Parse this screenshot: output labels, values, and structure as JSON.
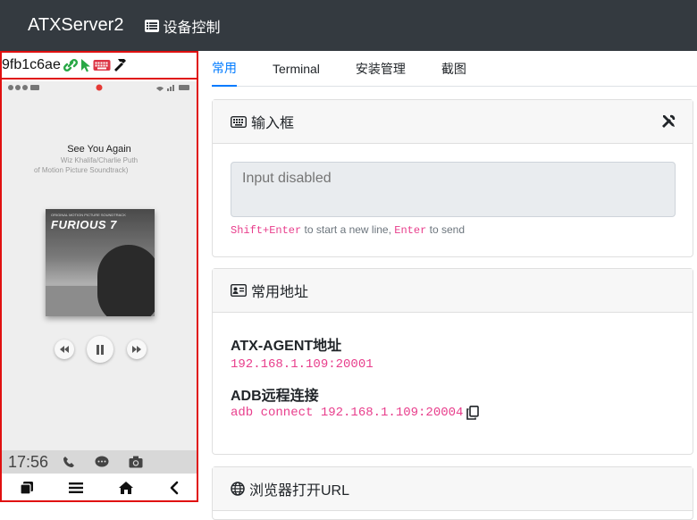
{
  "navbar": {
    "brand": "ATXServer2",
    "device_control": "设备控制"
  },
  "device": {
    "serial": "9fb1c6ae"
  },
  "phone": {
    "song_title": "See You Again",
    "song_artist": "Wiz Khalifa/Charlie Puth",
    "song_album": "of Motion Picture Soundtrack)",
    "album_title": "FURIOUS 7",
    "album_subtitle": "ORIGINAL MOTION PICTURE SOUNDTRACK",
    "clock": "17:56"
  },
  "tabs": [
    {
      "label": "常用",
      "active": true
    },
    {
      "label": "Terminal",
      "active": false
    },
    {
      "label": "安装管理",
      "active": false
    },
    {
      "label": "截图",
      "active": false
    }
  ],
  "input_card": {
    "title": "输入框",
    "placeholder": "Input disabled",
    "hint_key1": "Shift+Enter",
    "hint_text1": " to start a new line, ",
    "hint_key2": "Enter",
    "hint_text2": " to send"
  },
  "address_card": {
    "title": "常用地址",
    "agent_label": "ATX-AGENT地址",
    "agent_value": "192.168.1.109:20001",
    "adb_label": "ADB远程连接",
    "adb_value": "adb connect 192.168.1.109:20004"
  },
  "browser_card": {
    "title": "浏览器打开URL"
  },
  "colors": {
    "navbar_bg": "#343a40",
    "accent": "#007bff",
    "code": "#e83e8c",
    "device_border": "#e01010"
  }
}
